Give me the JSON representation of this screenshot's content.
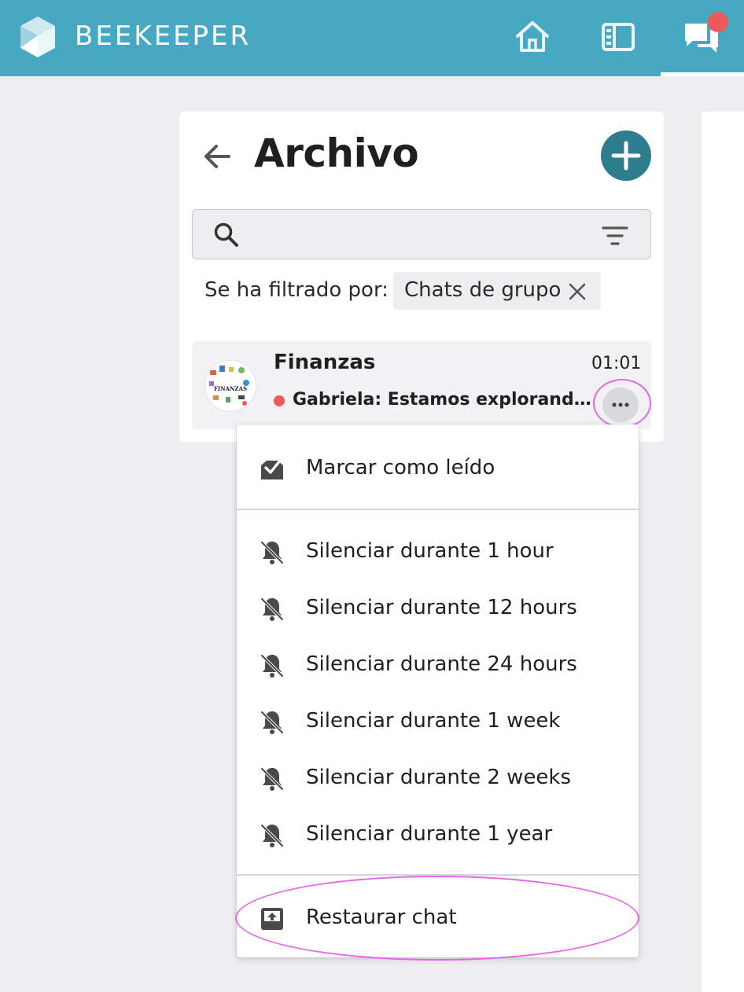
{
  "app": {
    "brand": "BEEKEEPER",
    "accent_color": "#46a8c3",
    "nav": [
      {
        "name": "home-icon",
        "active": false
      },
      {
        "name": "stream-icon",
        "active": false
      },
      {
        "name": "chat-icon",
        "active": true,
        "has_notification": true
      }
    ]
  },
  "panel": {
    "title": "Archivo",
    "search": {
      "placeholder": "",
      "value": ""
    },
    "filter": {
      "label": "Se ha filtrado por:",
      "chip": "Chats de grupo"
    },
    "chats": [
      {
        "name": "Finanzas",
        "time": "01:01",
        "preview": "Gabriela: Estamos explorando di...",
        "unread": true,
        "avatar_text": "FINANZAS"
      }
    ]
  },
  "menu": {
    "mark_read": "Marcar como leído",
    "mute_options": [
      "Silenciar durante 1 hour",
      "Silenciar durante 12 hours",
      "Silenciar durante 24 hours",
      "Silenciar durante 1 week",
      "Silenciar durante 2 weeks",
      "Silenciar durante 1 year"
    ],
    "restore": "Restaurar chat"
  }
}
